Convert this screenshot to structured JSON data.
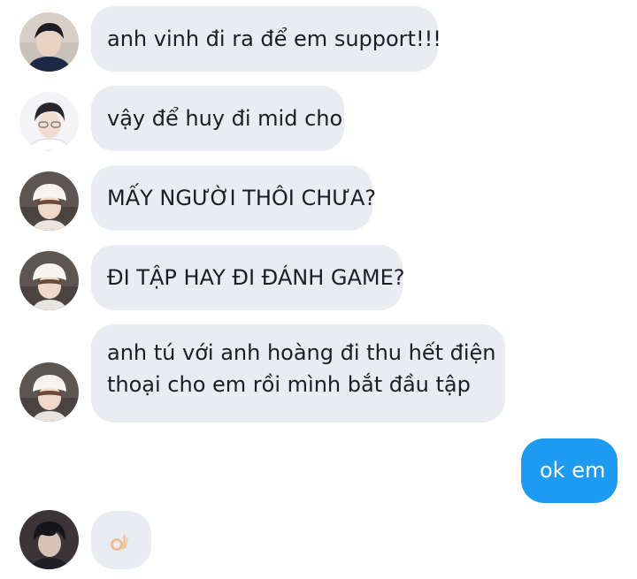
{
  "conversation": {
    "messages": [
      {
        "sender": "avatar-1",
        "direction": "received",
        "text": "anh vinh đi ra để em support!!!"
      },
      {
        "sender": "avatar-2",
        "direction": "received",
        "text": "vậy để huy đi mid cho"
      },
      {
        "sender": "avatar-3",
        "direction": "received",
        "text": "MẤY NGƯỜI THÔI CHƯA?"
      },
      {
        "sender": "avatar-3",
        "direction": "received",
        "text": "ĐI TẬP HAY ĐI ĐÁNH GAME?"
      },
      {
        "sender": "avatar-3",
        "direction": "received",
        "lines": [
          "anh tú với anh hoàng đi thu hết điện",
          "thoại cho em rồi mình bắt đầu tập"
        ]
      },
      {
        "sender": "me",
        "direction": "sent",
        "text": "ok em"
      },
      {
        "sender": "avatar-4",
        "direction": "received",
        "emoji": "ok-hand-icon"
      }
    ]
  },
  "colors": {
    "received_bubble": "#e9ecf1",
    "sent_bubble": "#1d9bf0",
    "text_dark": "#1b1f24",
    "text_light": "#ffffff"
  }
}
